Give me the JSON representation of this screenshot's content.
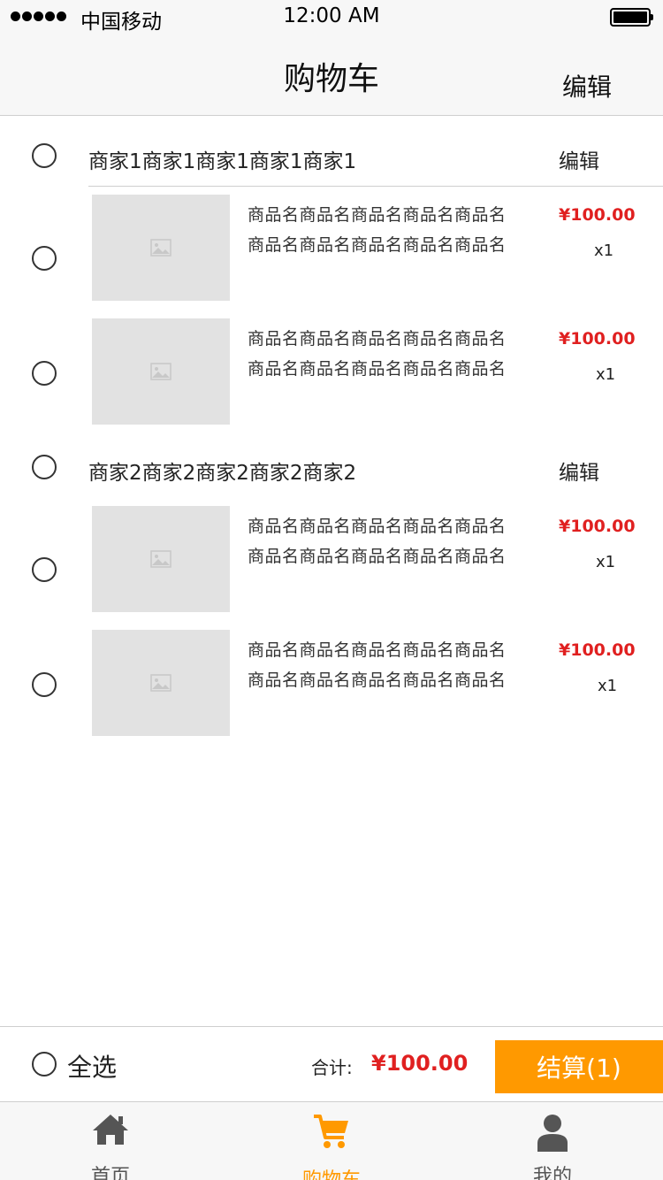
{
  "status_bar": {
    "carrier": "中国移动",
    "time": "12:00 AM"
  },
  "nav": {
    "title": "购物车",
    "edit_label": "编辑"
  },
  "shops": [
    {
      "name": "商家1商家1商家1商家1商家1",
      "edit_label": "编辑",
      "items": [
        {
          "name": "商品名商品名商品名商品名商品名商品名商品名商品名商品名商品名",
          "price": "¥100.00",
          "qty": "x1"
        },
        {
          "name": "商品名商品名商品名商品名商品名商品名商品名商品名商品名商品名",
          "price": "¥100.00",
          "qty": "x1"
        }
      ]
    },
    {
      "name": "商家2商家2商家2商家2商家2",
      "edit_label": "编辑",
      "items": [
        {
          "name": "商品名商品名商品名商品名商品名商品名商品名商品名商品名商品名",
          "price": "¥100.00",
          "qty": "x1"
        },
        {
          "name": "商品名商品名商品名商品名商品名商品名商品名商品名商品名商品名",
          "price": "¥100.00",
          "qty": "x1"
        }
      ]
    }
  ],
  "checkout": {
    "select_all_label": "全选",
    "total_label": "合计:",
    "total_value": "¥100.00",
    "button_label": "结算(1)"
  },
  "tabs": [
    {
      "label": "首页",
      "icon": "home-icon"
    },
    {
      "label": "购物车",
      "icon": "cart-icon",
      "active": true
    },
    {
      "label": "我的",
      "icon": "user-icon"
    }
  ],
  "colors": {
    "accent": "#ff9900",
    "price": "#e02020",
    "placeholder": "#e2e2e2"
  }
}
